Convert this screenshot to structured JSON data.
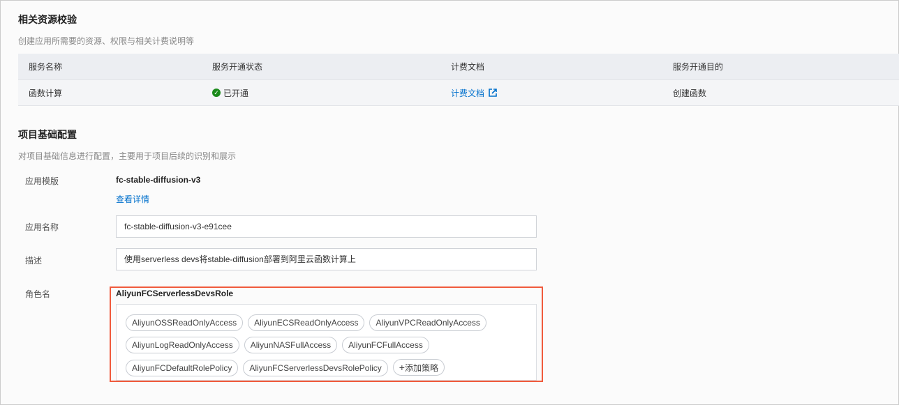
{
  "section1": {
    "title": "相关资源校验",
    "subtitle": "创建应用所需要的资源、权限与相关计费说明等",
    "columns": [
      "服务名称",
      "服务开通状态",
      "计费文档",
      "服务开通目的"
    ],
    "rows": [
      {
        "name": "函数计算",
        "status": "已开通",
        "doc": "计费文档",
        "purpose": "创建函数"
      }
    ]
  },
  "section2": {
    "title": "项目基础配置",
    "subtitle": "对项目基础信息进行配置，主要用于项目后续的识别和展示",
    "template_label": "应用模版",
    "template_value": "fc-stable-diffusion-v3",
    "template_link": "查看详情",
    "name_label": "应用名称",
    "name_value": "fc-stable-diffusion-v3-e91cee",
    "desc_label": "描述",
    "desc_value": "使用serverless devs将stable-diffusion部署到阿里云函数计算上",
    "role_label": "角色名",
    "role_value": "AliyunFCServerlessDevsRole",
    "policies": [
      [
        "AliyunOSSReadOnlyAccess",
        "AliyunECSReadOnlyAccess",
        "AliyunVPCReadOnlyAccess"
      ],
      [
        "AliyunLogReadOnlyAccess",
        "AliyunNASFullAccess",
        "AliyunFCFullAccess"
      ],
      [
        "AliyunFCDefaultRolePolicy",
        "AliyunFCServerlessDevsRolePolicy"
      ]
    ],
    "add_policy": "添加策略"
  },
  "colors": {
    "highlight": "#f05a3c",
    "link": "#0070cc",
    "success": "#1a8a1a"
  }
}
